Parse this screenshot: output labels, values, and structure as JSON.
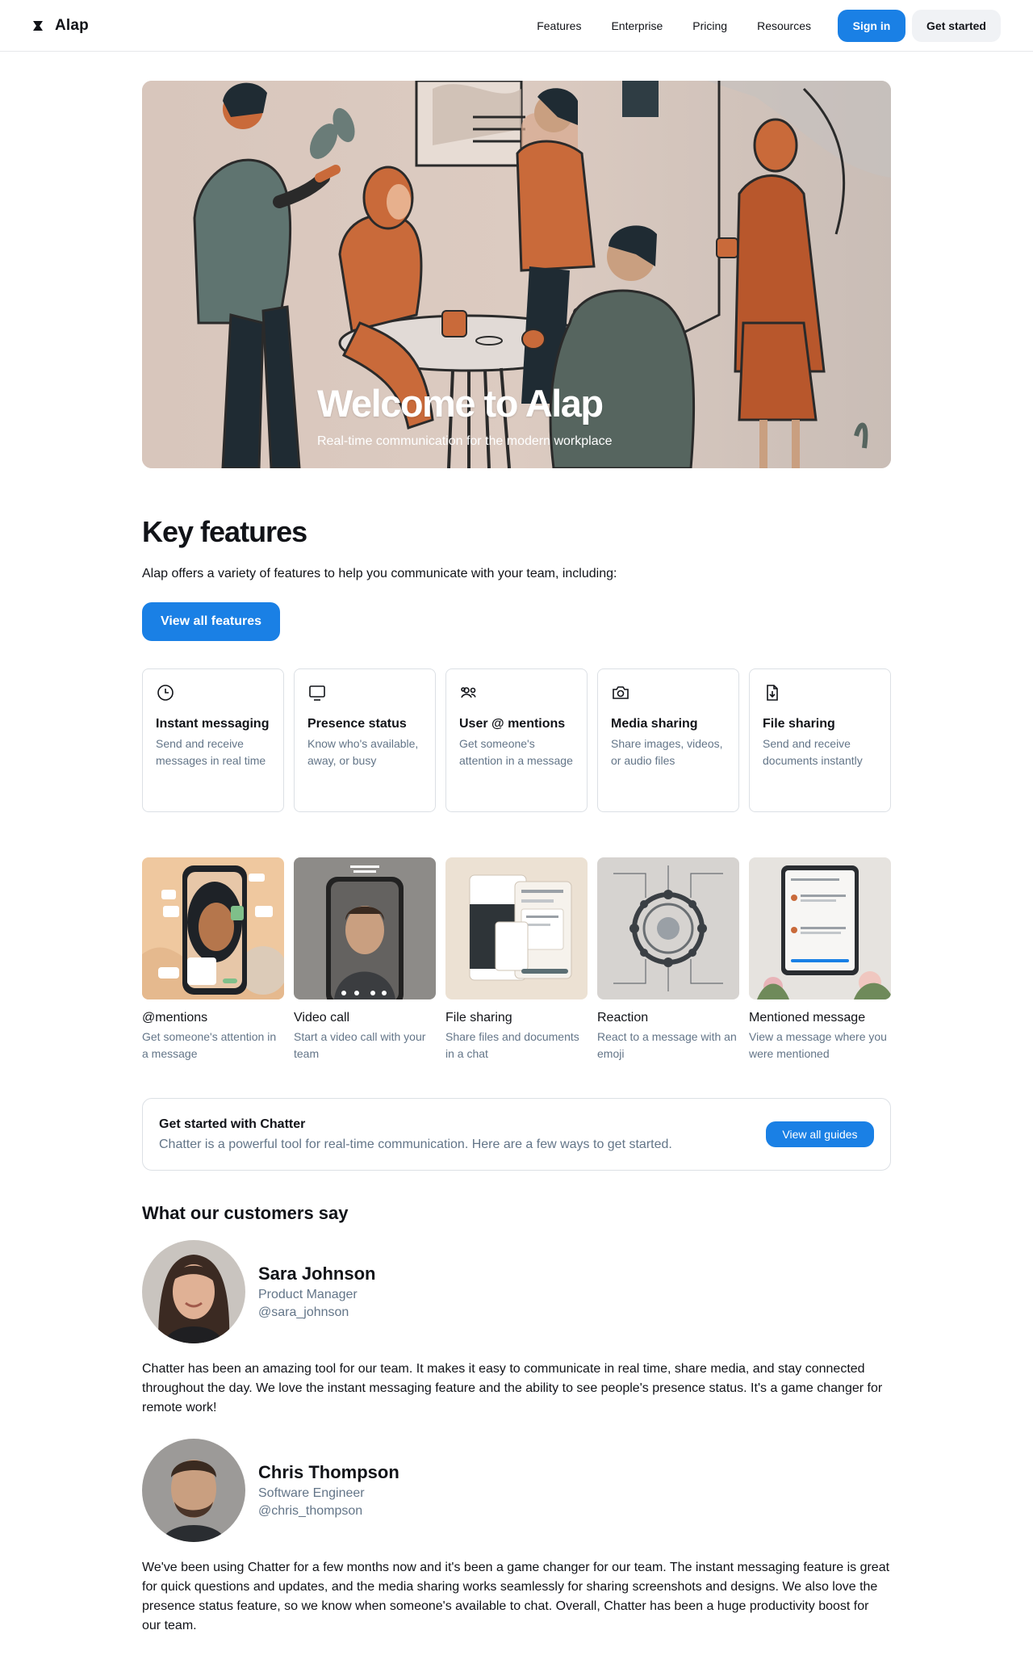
{
  "header": {
    "brand": "Alap",
    "nav": [
      "Features",
      "Enterprise",
      "Pricing",
      "Resources"
    ],
    "sign_in": "Sign in",
    "get_started": "Get started"
  },
  "hero": {
    "title": "Welcome to Alap",
    "subtitle": "Real-time communication for the modern workplace"
  },
  "key_features": {
    "title": "Key features",
    "description": "Alap offers a variety of features to help you communicate with your team, including:",
    "button": "View all features",
    "cards": [
      {
        "icon": "clock-icon",
        "title": "Instant messaging",
        "desc": "Send and receive messages in real time"
      },
      {
        "icon": "monitor-icon",
        "title": "Presence status",
        "desc": "Know who's available, away, or busy"
      },
      {
        "icon": "users-icon",
        "title": "User @ mentions",
        "desc": "Get someone's attention in a message"
      },
      {
        "icon": "camera-icon",
        "title": "Media sharing",
        "desc": "Share images, videos, or audio files"
      },
      {
        "icon": "file-download-icon",
        "title": "File sharing",
        "desc": "Send and receive documents instantly"
      }
    ]
  },
  "media": [
    {
      "title": "@mentions",
      "desc": "Get someone's attention in a message"
    },
    {
      "title": "Video call",
      "desc": "Start a video call with your team"
    },
    {
      "title": "File sharing",
      "desc": "Share files and documents in a chat"
    },
    {
      "title": "Reaction",
      "desc": "React to a message with an emoji"
    },
    {
      "title": "Mentioned message",
      "desc": "View a message where you were mentioned"
    }
  ],
  "get_started_box": {
    "title": "Get started with Chatter",
    "subtitle": "Chatter is a powerful tool for real-time communication. Here are a few ways to get started.",
    "button": "View all guides"
  },
  "testimonials": {
    "title": "What our customers say",
    "items": [
      {
        "name": "Sara Johnson",
        "role": "Product Manager",
        "handle": "@sara_johnson",
        "quote": "Chatter has been an amazing tool for our team. It makes it easy to communicate in real time, share media, and stay connected throughout the day. We love the instant messaging feature and the ability to see people's presence status. It's a game changer for remote work!"
      },
      {
        "name": "Chris Thompson",
        "role": "Software Engineer",
        "handle": "@chris_thompson",
        "quote": "We've been using Chatter for a few months now and it's been a game changer for our team. The instant messaging feature is great for quick questions and updates, and the media sharing works seamlessly for sharing screenshots and designs. We also love the presence status feature, so we know when someone's available to chat. Overall, Chatter has been a huge productivity boost for our team."
      }
    ]
  },
  "colors": {
    "primary": "#1a80e5",
    "muted_text": "#637588",
    "border": "#dce0e5"
  }
}
